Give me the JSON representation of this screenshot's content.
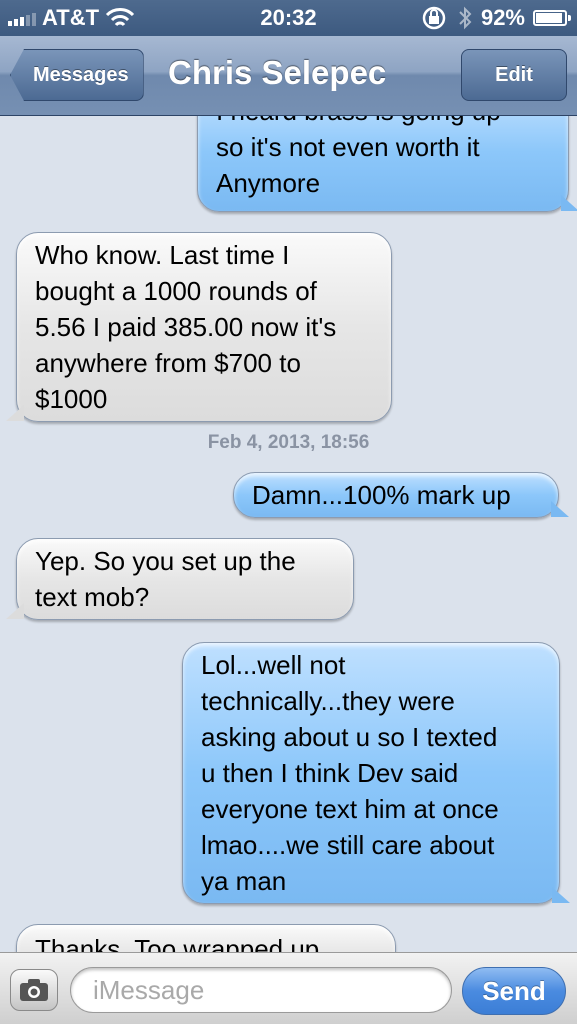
{
  "status_bar": {
    "carrier": "AT&T",
    "time": "20:32",
    "battery": "92%",
    "battery_level": 0.92,
    "icons": [
      "signal-icon",
      "wifi-icon",
      "rotation-lock-icon",
      "bluetooth-icon",
      "battery-icon"
    ]
  },
  "nav": {
    "back_label": "Messages",
    "title": "Chris Selepec",
    "edit_label": "Edit"
  },
  "messages": [
    {
      "direction": "sent",
      "lines": [
        "I heard brass is going up",
        "so it's not even worth it",
        "Anymore"
      ]
    },
    {
      "direction": "received",
      "lines": [
        "Who know. Last time I",
        "bought a 1000 rounds of",
        "5.56 I paid 385.00 now it's",
        "anywhere from $700 to",
        "$1000"
      ]
    },
    {
      "direction": "sent",
      "lines": [
        "Damn...100% mark up"
      ]
    },
    {
      "direction": "received",
      "lines": [
        "Yep. So you set up the",
        "text mob?"
      ]
    },
    {
      "direction": "sent",
      "lines": [
        "Lol...well not",
        "technically...they were",
        "asking about u so I texted",
        "u then I think Dev said",
        "everyone text him at once",
        "lmao....we still care about",
        "ya man"
      ]
    },
    {
      "direction": "received",
      "lines": [
        "Thanks. Too wrapped up"
      ]
    }
  ],
  "timestamp": "Feb 4, 2013, 18:56",
  "input_bar": {
    "placeholder": "iMessage",
    "send_label": "Send",
    "camera_icon": "camera-icon"
  },
  "colors": {
    "sent_bubble": "#8cc7fa",
    "received_bubble": "#e6e6e6",
    "nav_bar": "#7690b3",
    "background": "#dbe2ec",
    "send_button": "#4a8be0"
  }
}
